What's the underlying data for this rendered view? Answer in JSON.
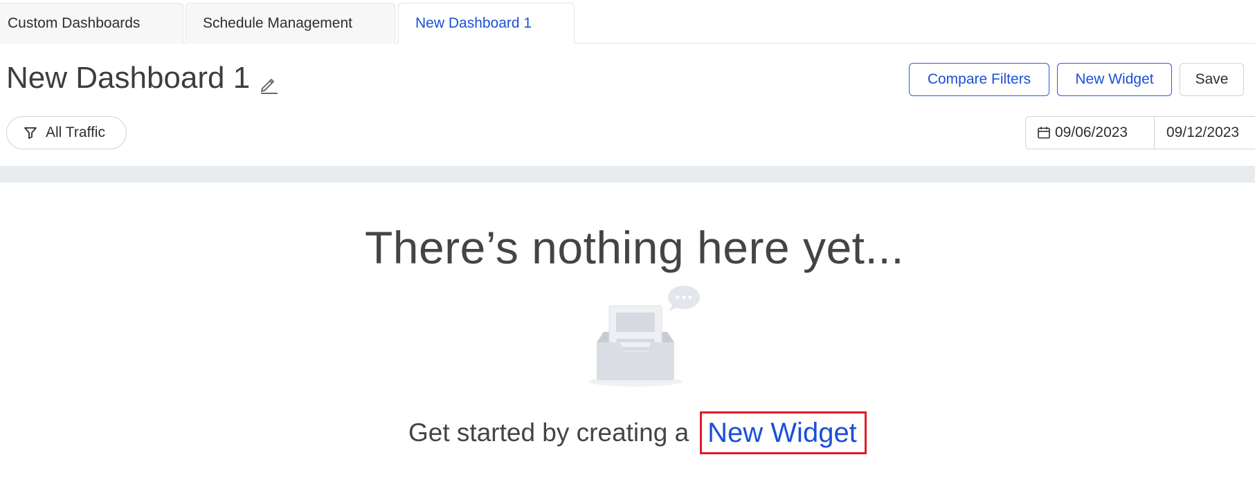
{
  "tabs": [
    {
      "label": "Custom Dashboards",
      "active": false
    },
    {
      "label": "Schedule Management",
      "active": false
    },
    {
      "label": "New Dashboard 1",
      "active": true
    }
  ],
  "header": {
    "title": "New Dashboard 1",
    "edit_icon": "pencil-icon"
  },
  "toolbar": {
    "compare_filters_label": "Compare Filters",
    "new_widget_label": "New Widget",
    "save_label": "Save"
  },
  "filter": {
    "icon": "funnel-icon",
    "label": "All Traffic"
  },
  "date_range": {
    "icon": "calendar-icon",
    "start": "09/06/2023",
    "end": "09/12/2023"
  },
  "empty_state": {
    "title": "There’s nothing here yet...",
    "illustration": "empty-inbox-icon",
    "prompt": "Get started by creating a",
    "link_label": "New Widget"
  },
  "colors": {
    "accent": "#1a4fd8",
    "highlight": "#e01b24",
    "band": "#e9ecef"
  }
}
